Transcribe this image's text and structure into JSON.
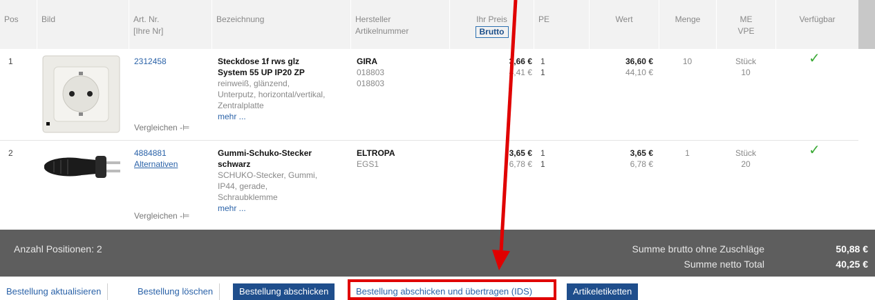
{
  "header": {
    "pos": "Pos",
    "bild": "Bild",
    "artnr": "Art. Nr.",
    "artnr_sub": "[Ihre Nr]",
    "bezeichnung": "Bezeichnung",
    "hersteller": "Hersteller",
    "hersteller_sub": "Artikelnummer",
    "preis": "Ihr Preis",
    "brutto_button": "Brutto",
    "pe": "PE",
    "wert": "Wert",
    "menge": "Menge",
    "me": "ME",
    "me_sub": "VPE",
    "verfuegbar": "Verfügbar"
  },
  "rows": [
    {
      "pos": "1",
      "artnr": "2312458",
      "alternativen": "",
      "vergleichen": "Vergleichen",
      "name_line1": "Steckdose 1f rws glz",
      "name_line2": "System 55 UP IP20 ZP",
      "desc": [
        "reinweiß, glänzend,",
        "Unterputz, horizontal/vertikal,",
        "Zentralplatte"
      ],
      "mehr": "mehr ...",
      "hersteller": "GIRA",
      "hersteller_nr1": "018803",
      "hersteller_nr2": "018803",
      "preis_netto": "3,66 €",
      "preis_brutto": "4,41 €",
      "pe1": "1",
      "pe2": "1",
      "wert_netto": "36,60 €",
      "wert_brutto": "44,10 €",
      "menge": "10",
      "me": "Stück",
      "vpe": "10",
      "verfuegbar": "✓"
    },
    {
      "pos": "2",
      "artnr": "4884881",
      "alternativen": "Alternativen",
      "vergleichen": "Vergleichen",
      "name_line1": "Gummi-Schuko-Stecker",
      "name_line2": "schwarz",
      "desc": [
        "SCHUKO-Stecker, Gummi,",
        "IP44, gerade,",
        "Schraubklemme"
      ],
      "mehr": "mehr ...",
      "hersteller": "ELTROPA",
      "hersteller_nr1": "EGS1",
      "hersteller_nr2": "",
      "preis_netto": "3,65 €",
      "preis_brutto": "6,78 €",
      "pe1": "1",
      "pe2": "1",
      "wert_netto": "3,65 €",
      "wert_brutto": "6,78 €",
      "menge": "1",
      "me": "Stück",
      "vpe": "20",
      "verfuegbar": "✓"
    }
  ],
  "summary": {
    "anzahl": "Anzahl Positionen: 2",
    "brutto_label": "Summe brutto ohne Zuschläge",
    "brutto_value": "50,88 €",
    "netto_label": "Summe netto Total",
    "netto_value": "40,25 €"
  },
  "buttons": {
    "aktualisieren": "Bestellung aktualisieren",
    "loeschen": "Bestellung löschen",
    "abschicken": "Bestellung abschicken",
    "abschicken_ids": "Bestellung abschicken und übertragen (IDS)",
    "etiketten": "Artikeletiketten"
  },
  "icons": {
    "compare": "pin-icon",
    "available": "checkmark-icon",
    "annotation": "red-arrow-icon"
  },
  "colors": {
    "highlight": "#e00000",
    "available": "#3aaa35",
    "primary_button": "#1f4e8c"
  }
}
